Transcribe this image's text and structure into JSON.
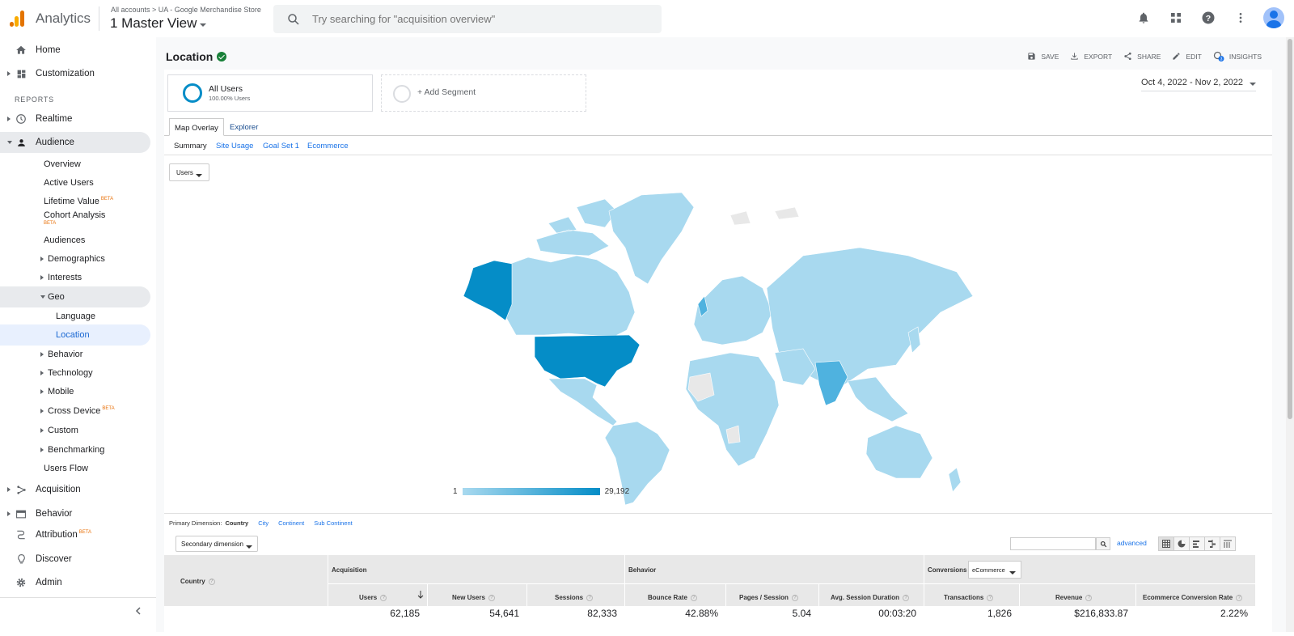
{
  "header": {
    "app_name": "Analytics",
    "breadcrumb": "All accounts > UA - Google Merchandise Store",
    "view_name": "1 Master View",
    "search_placeholder": "Try searching for \"acquisition overview\""
  },
  "sidebar": {
    "home": "Home",
    "customization": "Customization",
    "reports_label": "REPORTS",
    "realtime": "Realtime",
    "audience": "Audience",
    "overview": "Overview",
    "active_users": "Active Users",
    "lifetime_value": "Lifetime Value",
    "cohort_analysis": "Cohort Analysis",
    "audiences": "Audiences",
    "demographics": "Demographics",
    "interests": "Interests",
    "geo": "Geo",
    "language": "Language",
    "location": "Location",
    "behavior_sub": "Behavior",
    "technology": "Technology",
    "mobile": "Mobile",
    "cross_device": "Cross Device",
    "custom": "Custom",
    "benchmarking": "Benchmarking",
    "users_flow": "Users Flow",
    "acquisition": "Acquisition",
    "behavior": "Behavior",
    "attribution": "Attribution",
    "discover": "Discover",
    "admin": "Admin",
    "beta": "BETA"
  },
  "page": {
    "title": "Location",
    "actions": [
      "SAVE",
      "EXPORT",
      "SHARE",
      "EDIT",
      "INSIGHTS"
    ],
    "insights_count": "3",
    "segment_name": "All Users",
    "segment_pct": "100.00% Users",
    "add_segment": "+ Add Segment",
    "date_range": "Oct 4, 2022 - Nov 2, 2022",
    "tabs": [
      "Map Overlay",
      "Explorer"
    ],
    "subtabs": [
      "Summary",
      "Site Usage",
      "Goal Set 1",
      "Ecommerce"
    ],
    "metric": "Users",
    "legend_min": "1",
    "legend_max": "29,192",
    "primary_dimension_label": "Primary Dimension:",
    "primary_dimension": "Country",
    "dimension_options": [
      "City",
      "Continent",
      "Sub Continent"
    ],
    "secondary_dimension": "Secondary dimension",
    "advanced": "advanced"
  },
  "table": {
    "country_header": "Country",
    "groups": [
      "Acquisition",
      "Behavior",
      "Conversions"
    ],
    "conversion_type": "eCommerce",
    "columns": [
      "Users",
      "New Users",
      "Sessions",
      "Bounce Rate",
      "Pages / Session",
      "Avg. Session Duration",
      "Transactions",
      "Revenue",
      "Ecommerce Conversion Rate"
    ],
    "totals": [
      "62,185",
      "54,641",
      "82,333",
      "42.88%",
      "5.04",
      "00:03:20",
      "1,826",
      "$216,833.87",
      "2.22%"
    ]
  },
  "colors": {
    "map_base": "#a8d9ef",
    "map_high": "#058dc7",
    "map_mid": "#4fb2df",
    "accent": "#1a73e8"
  }
}
